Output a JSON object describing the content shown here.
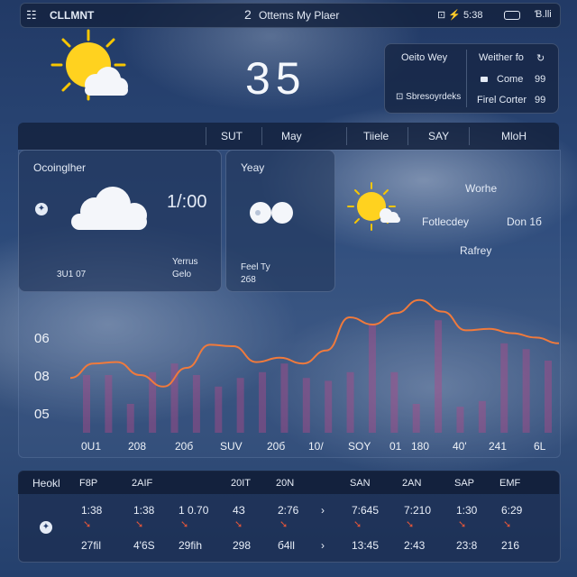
{
  "topbar": {
    "menu_icon": "menu-icon",
    "app_name": "CLLMNT",
    "search_number": "2",
    "search_text": "Ottems My Plaer",
    "status_right": "⊡ ⚡ 5:38",
    "battery_icon": "battery-icon",
    "user": "Ɓ.lli"
  },
  "current": {
    "temperature": "35",
    "sun_icon": "sun-cloud-icon"
  },
  "summary_card": {
    "left_title": "Oeito Wey",
    "left_footer": "⊡ Sbresoyrdeks",
    "right_row1_label": "Weither fo",
    "right_row1_value": "↻",
    "right_row2_label": "Come",
    "right_row2_value": "99",
    "right_row3_label": "Firel Corter",
    "right_row3_value": "99"
  },
  "tabs": [
    "SUT",
    "May",
    "Tiiele",
    "SAY",
    "MloH"
  ],
  "card_left": {
    "title": "Ocoinglher",
    "time": "1/:00",
    "bottom_left": "3U1 07",
    "bottom_right_1": "Yerrus",
    "bottom_right_2": "Gelo"
  },
  "card_mid": {
    "title": "Yeay",
    "bottom_1": "Feel Ty",
    "bottom_2": "2б8"
  },
  "floating": {
    "label1": "Worhe",
    "label2": "Fotlecdey",
    "label3": "Don 1б",
    "label4": "Rafrey"
  },
  "chart_data": {
    "type": "line",
    "y_tick_labels": [
      "06",
      "08",
      "05"
    ],
    "x_tick_labels": [
      "0U1",
      "208",
      "20б",
      "SUV",
      "20б",
      "10/",
      "SOY",
      "01",
      "180",
      "40'",
      "241",
      "6L"
    ],
    "series": [
      {
        "values": [
          0.38,
          0.48,
          0.49,
          0.4,
          0.32,
          0.45,
          0.61,
          0.6,
          0.49,
          0.52,
          0.48,
          0.57,
          0.8,
          0.75,
          0.83,
          0.92,
          0.84,
          0.71,
          0.72,
          0.69,
          0.66,
          0.62
        ]
      }
    ],
    "bar_values": [
      0.4,
      0.4,
      0.2,
      0.42,
      0.48,
      0.4,
      0.32,
      0.38,
      0.42,
      0.48,
      0.38,
      0.36,
      0.42,
      0.75,
      0.42,
      0.2,
      0.78,
      0.18,
      0.22,
      0.62,
      0.58,
      0.5
    ],
    "grid": false,
    "line_color": "#f07a3c",
    "bar_color": "#b04a8a"
  },
  "forecast": {
    "header_label": "Heokl",
    "columns": [
      {
        "day": "F8P",
        "top": "1:38",
        "bottom": "27fil"
      },
      {
        "day": "2AIF",
        "top": "1:38",
        "bottom": "4'6S"
      },
      {
        "day": "",
        "top": "1 0.70",
        "bottom": "29fih"
      },
      {
        "day": "20IT",
        "top": "4З",
        "bottom": "298"
      },
      {
        "day": "20N",
        "top": "2:76",
        "bottom": "б4ll"
      },
      {
        "day": "",
        "top": "›",
        "bottom": "›"
      },
      {
        "day": "SAN",
        "top": "7:645",
        "bottom": "13:45"
      },
      {
        "day": "2AN",
        "top": "7:210",
        "bottom": "2:43"
      },
      {
        "day": "SAP",
        "top": "1:30",
        "bottom": "23:8"
      },
      {
        "day": "EMF",
        "top": "6:29",
        "bottom": "216"
      }
    ],
    "row_icon": "sun-small-icon"
  },
  "colors": {
    "accent_line": "#f07a3c",
    "bar": "#b04a8a",
    "marker": "#e2563a"
  }
}
